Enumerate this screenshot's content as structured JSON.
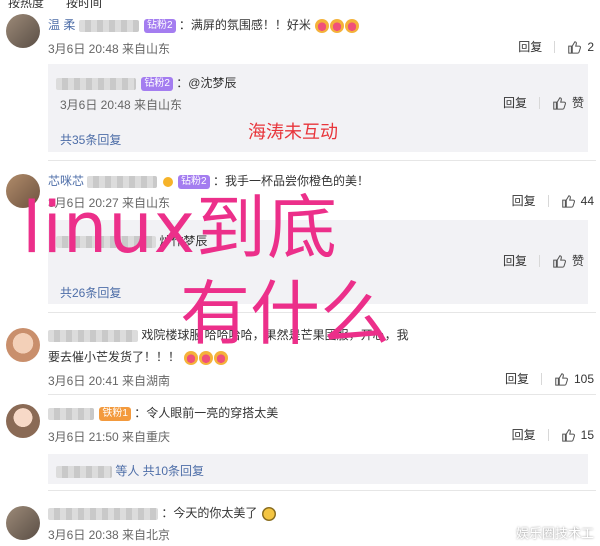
{
  "header": {
    "left": "按热度",
    "right": "按时间"
  },
  "comments": [
    {
      "username": "温 柔 ",
      "badge": "钻粉2",
      "text": "：满屏的氛围感！！好米",
      "meta": "3月6日 20:48 来自山东",
      "reply_label": "回复",
      "likes": "2",
      "sub": {
        "badge": "钻粉2",
        "text": "：@沈梦辰",
        "meta": "3月6日 20:48 来自山东",
        "reply_label": "回复",
        "like_label": "赞"
      },
      "total": "共35条回复"
    },
    {
      "username": "芯咪芯",
      "badge": "钻粉2",
      "text": "：我手一杯品尝你橙色的美！",
      "meta": "3月6日 20:27 来自山东",
      "reply_label": "回复",
      "likes": "44",
      "sub": {
        "text": "炒作梦辰",
        "reply_label": "回复",
        "like_label": "赞"
      },
      "total": "共26条回复"
    },
    {
      "text_line1": "戏院楼球服 哈哈哈哈，果然是芒果团服，开心，我",
      "text_line2": "要去催小芒发货了！！！",
      "meta": "3月6日 20:41 来自湖南",
      "reply_label": "回复",
      "likes": "105"
    },
    {
      "badge": "铁粉1",
      "text": "：令人眼前一亮的穿搭太美",
      "meta": "3月6日 21:50 来自重庆",
      "reply_label": "回复",
      "likes": "15",
      "sub_summary": "等人 共10条回复"
    },
    {
      "text": "：今天的你太美了",
      "meta": "3月6日 20:38 来自北京"
    }
  ],
  "overlay": {
    "small_text": "海涛未互动",
    "big_line1": "linux到底",
    "big_line2": "有什么"
  },
  "watermark": "娱乐圈技术工"
}
